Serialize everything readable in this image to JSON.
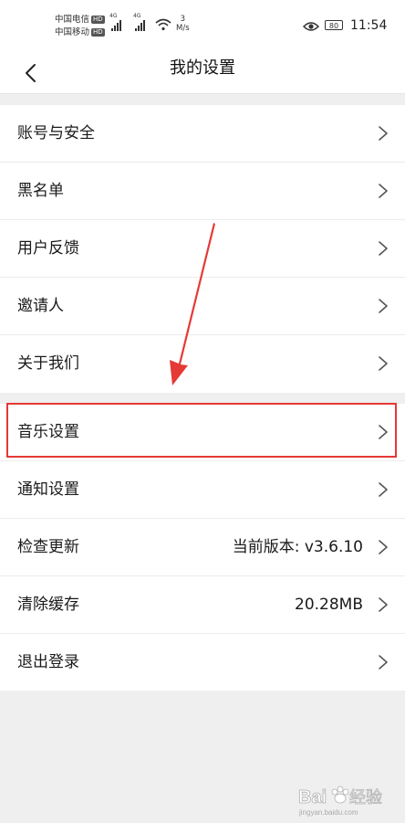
{
  "status_bar": {
    "carrier1": "中国电信",
    "carrier2": "中国移动",
    "hd_badge": "HD",
    "network1": "4G",
    "network2": "4G",
    "speed_value": "3",
    "speed_unit": "M/s",
    "battery": "80",
    "time": "11:54"
  },
  "header": {
    "title": "我的设置",
    "back_icon": "chevron-left-icon"
  },
  "settings": {
    "group1": [
      {
        "label": "账号与安全"
      },
      {
        "label": "黑名单"
      },
      {
        "label": "用户反馈"
      },
      {
        "label": "邀请人"
      },
      {
        "label": "关于我们"
      }
    ],
    "group2": [
      {
        "label": "音乐设置"
      },
      {
        "label": "通知设置"
      },
      {
        "label": "检查更新",
        "value": "当前版本: v3.6.10"
      },
      {
        "label": "清除缓存",
        "value": "20.28MB"
      },
      {
        "label": "退出登录"
      }
    ]
  },
  "annotation": {
    "highlight_color": "#e53935",
    "highlighted_item": "音乐设置"
  },
  "watermark": {
    "text": "Baidu经验",
    "subtext": "jingyan.baidu.com"
  }
}
